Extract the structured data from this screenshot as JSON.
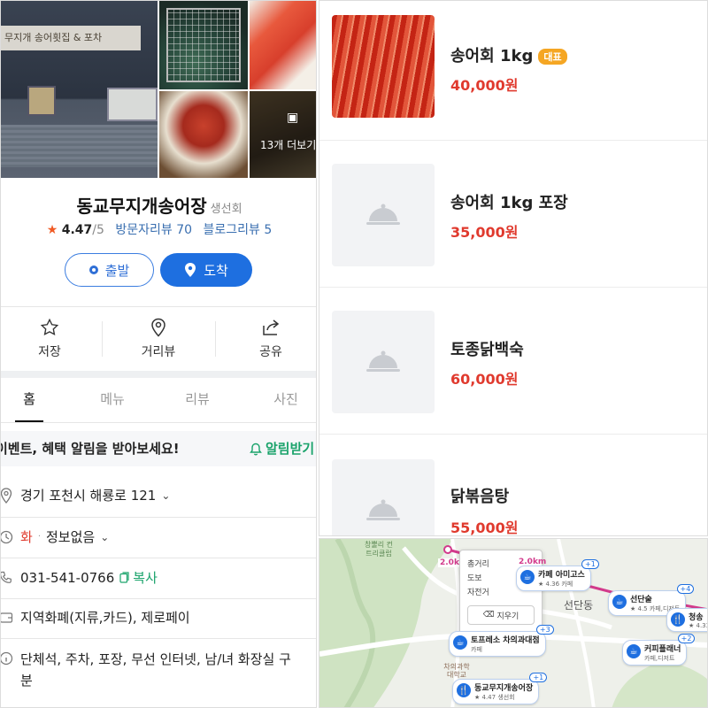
{
  "place": {
    "photos": {
      "storefront_sign": "무지개 송어횟집 & 포차",
      "more_count": "13개 더보기"
    },
    "name": "동교무지개송어장",
    "category": "생선회",
    "rating": "4.47",
    "rating_max": "/5",
    "visitor_reviews": "방문자리뷰 70",
    "blog_reviews": "블로그리뷰 5",
    "depart_label": "출발",
    "arrive_label": "도착",
    "actions": {
      "save": "저장",
      "street_view": "거리뷰",
      "share": "공유"
    },
    "tabs": [
      "홈",
      "메뉴",
      "리뷰",
      "사진"
    ],
    "notice": {
      "text": "이벤트, 혜택 알림을 받아보세요!",
      "cta": "알림받기"
    },
    "address": "경기 포천시 해룡로 121",
    "hours": {
      "day": "화",
      "status": "정보없음"
    },
    "phone": "031-541-0766",
    "copy_label": "복사",
    "payment": "지역화폐(지류,카드), 제로페이",
    "facilities": [
      "단체석, 주차, 포장, 무선 인터넷, 남/녀 화장실 구",
      "분"
    ]
  },
  "menu": [
    {
      "name": "송어회 1kg",
      "badge": "대표",
      "price": "40,000원"
    },
    {
      "name": "송어회 1kg 포장",
      "price": "35,000원"
    },
    {
      "name": "토종닭백숙",
      "price": "60,000원"
    },
    {
      "name": "닭볶음탕",
      "price": "55,000원"
    }
  ],
  "map": {
    "route_popup": {
      "total": "총거리",
      "total_val": "2.0km",
      "walk": "도보",
      "bike": "자전거",
      "erase": "지우기"
    },
    "route_distance": "2.0km",
    "area_labels": {
      "hill": "창뿔리 컨트리클럽",
      "district": "선단동",
      "school": "차의과학대학교"
    },
    "pois": [
      {
        "name": "카페 아미고스",
        "rating": "★ 4.36",
        "type": "카페",
        "plus": "+1"
      },
      {
        "name": "선단술",
        "rating": "★ 4.5",
        "type": "카페,디저트",
        "plus": "+4"
      },
      {
        "name": "청송",
        "rating": "★ 4.33",
        "type": "",
        "plus": ""
      },
      {
        "name": "토프레소 차의과대점",
        "rating": "",
        "type": "카페",
        "plus": "+3"
      },
      {
        "name": "커피플래너",
        "rating": "",
        "type": "카페,디저트",
        "plus": "+2"
      },
      {
        "name": "동교무지개송어장",
        "rating": "★ 4.47",
        "type": "생선회",
        "plus": "+1"
      }
    ]
  },
  "colors": {
    "accent": "#1e6fe0",
    "price": "#e03a2e",
    "star": "#f05a24",
    "green": "#1aa36b",
    "badge": "#f5a623"
  }
}
